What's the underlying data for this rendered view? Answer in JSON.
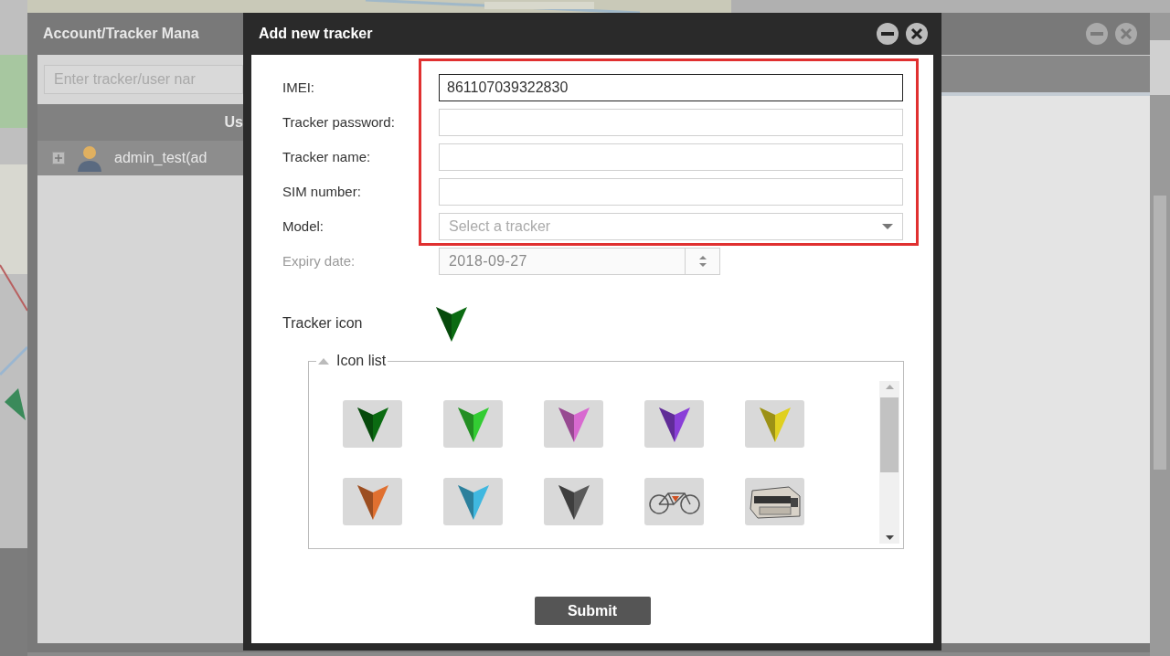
{
  "back_window": {
    "title": "Account/Tracker Mana",
    "search": {
      "placeholder": "Enter tracker/user nar"
    },
    "table": {
      "columns": [
        "Us"
      ],
      "rows": [
        {
          "label": "admin_test(ad",
          "expanded": false
        }
      ]
    }
  },
  "dialog": {
    "title": "Add new tracker",
    "fields": [
      {
        "kind": "text",
        "label": "IMEI:",
        "value": "861107039322830",
        "focused": true,
        "disabled": false
      },
      {
        "kind": "text",
        "label": "Tracker password:",
        "focused": false,
        "disabled": false
      },
      {
        "kind": "text",
        "label": "Tracker name:",
        "focused": false,
        "disabled": false
      },
      {
        "kind": "text",
        "label": "SIM number:",
        "focused": false,
        "disabled": false
      },
      {
        "kind": "select",
        "label": "Model:",
        "placeholder": "Select a tracker",
        "focused": false,
        "disabled": false
      },
      {
        "kind": "spinner",
        "label": "Expiry date:",
        "value": "2018-09-27",
        "focused": false,
        "disabled": true
      }
    ],
    "tracker_icon": {
      "label": "Tracker icon",
      "color": "#0b6b12"
    },
    "icon_list": {
      "legend": "Icon list",
      "expanded": true,
      "items": [
        {
          "kind": "arrow",
          "color": "#0b6b12"
        },
        {
          "kind": "arrow",
          "color": "#33cc33"
        },
        {
          "kind": "arrow",
          "color": "#d86ad0"
        },
        {
          "kind": "arrow",
          "color": "#8a3fd8"
        },
        {
          "kind": "arrow",
          "color": "#e0d020"
        },
        {
          "kind": "arrow",
          "color": "#e07030"
        },
        {
          "kind": "arrow",
          "color": "#40b8e0"
        },
        {
          "kind": "arrow",
          "color": "#5a5a5a"
        },
        {
          "kind": "bicycle"
        },
        {
          "kind": "bus"
        }
      ]
    },
    "submit": "Submit"
  }
}
